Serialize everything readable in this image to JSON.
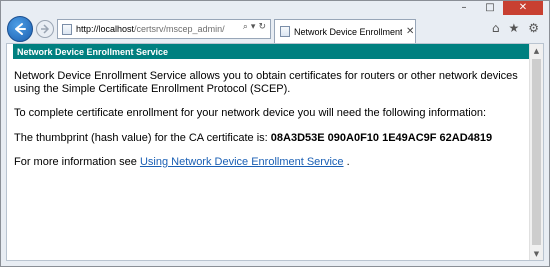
{
  "window": {
    "caption": {
      "minimize": "–",
      "maximize": "□",
      "close": "✕"
    }
  },
  "nav": {
    "address_host": "http://localhost",
    "address_rest": "/certsrv/mscep_admin/",
    "address_tools": {
      "search": "⌕",
      "dropdown": "▾",
      "refresh": "↻"
    },
    "tab_label": "Network Device Enrollment...",
    "tab_close": "✕",
    "toolbar": {
      "home": "⌂",
      "favorites": "★",
      "settings": "⚙"
    }
  },
  "page": {
    "header": "Network Device Enrollment Service",
    "intro": "Network Device Enrollment Service allows you to obtain certificates for routers or other network devices using the Simple Certificate Enrollment Protocol (SCEP).",
    "instructions": "To complete certificate enrollment for your network device you will need the following information:",
    "thumbprint_label": "The thumbprint (hash value) for the CA certificate is:",
    "thumbprint_value": "08A3D53E 090A0F10 1E49AC9F 62AD4819",
    "more_info_prefix": "For more information see",
    "more_info_link": "Using Network Device Enrollment Service",
    "more_info_suffix": "."
  },
  "scrollbar": {
    "up": "▲",
    "down": "▼"
  },
  "colors": {
    "header_bg": "#008080",
    "link": "#1a5fb4"
  }
}
